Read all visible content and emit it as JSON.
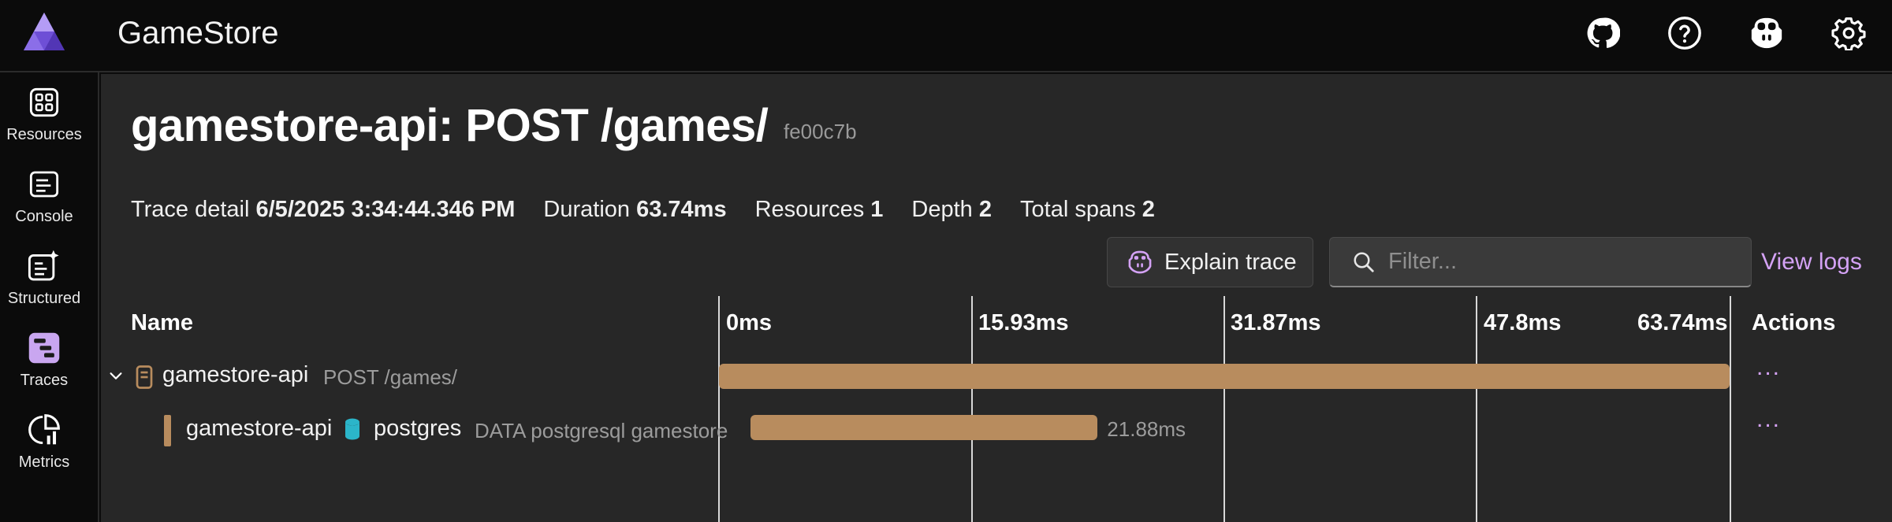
{
  "app": {
    "title": "GameStore"
  },
  "topbar": {
    "icons": [
      "github-icon",
      "help-icon",
      "copilot-icon",
      "settings-icon"
    ]
  },
  "nav": {
    "items": [
      {
        "label": "Resources",
        "icon": "resources-icon"
      },
      {
        "label": "Console",
        "icon": "console-icon"
      },
      {
        "label": "Structured",
        "icon": "structured-logs-icon"
      },
      {
        "label": "Traces",
        "icon": "traces-icon",
        "active": true
      },
      {
        "label": "Metrics",
        "icon": "metrics-icon"
      }
    ]
  },
  "page": {
    "title": "gamestore-api: POST /games/",
    "trace_id": "fe00c7b"
  },
  "summary": {
    "trace_detail_label": "Trace detail",
    "trace_detail_value": "6/5/2025 3:34:44.346 PM",
    "duration_label": "Duration",
    "duration_value": "63.74ms",
    "resources_label": "Resources",
    "resources_value": "1",
    "depth_label": "Depth",
    "depth_value": "2",
    "total_spans_label": "Total spans",
    "total_spans_value": "2"
  },
  "toolbar": {
    "explain_label": "Explain trace",
    "filter_placeholder": "Filter...",
    "view_logs_label": "View logs"
  },
  "table": {
    "headers": {
      "name": "Name",
      "actions": "Actions"
    },
    "ticks": [
      "0ms",
      "15.93ms",
      "31.87ms",
      "47.8ms",
      "63.74ms"
    ],
    "total_ms": 63.74,
    "rows": [
      {
        "resource": "gamestore-api",
        "name": "POST /games/",
        "start_ms": 0,
        "duration_ms": 63.74,
        "duration_label": "",
        "expanded": true
      },
      {
        "resource": "gamestore-api",
        "target": "postgres",
        "name": "DATA postgresql gamestore",
        "start_ms": 2.0,
        "duration_ms": 21.88,
        "duration_label": "21.88ms"
      }
    ],
    "actions_label": "..."
  },
  "colors": {
    "accent": "#d4a2f5",
    "span_bar": "#b88c5e",
    "database": "#2bb5c9",
    "background": "#272727"
  }
}
